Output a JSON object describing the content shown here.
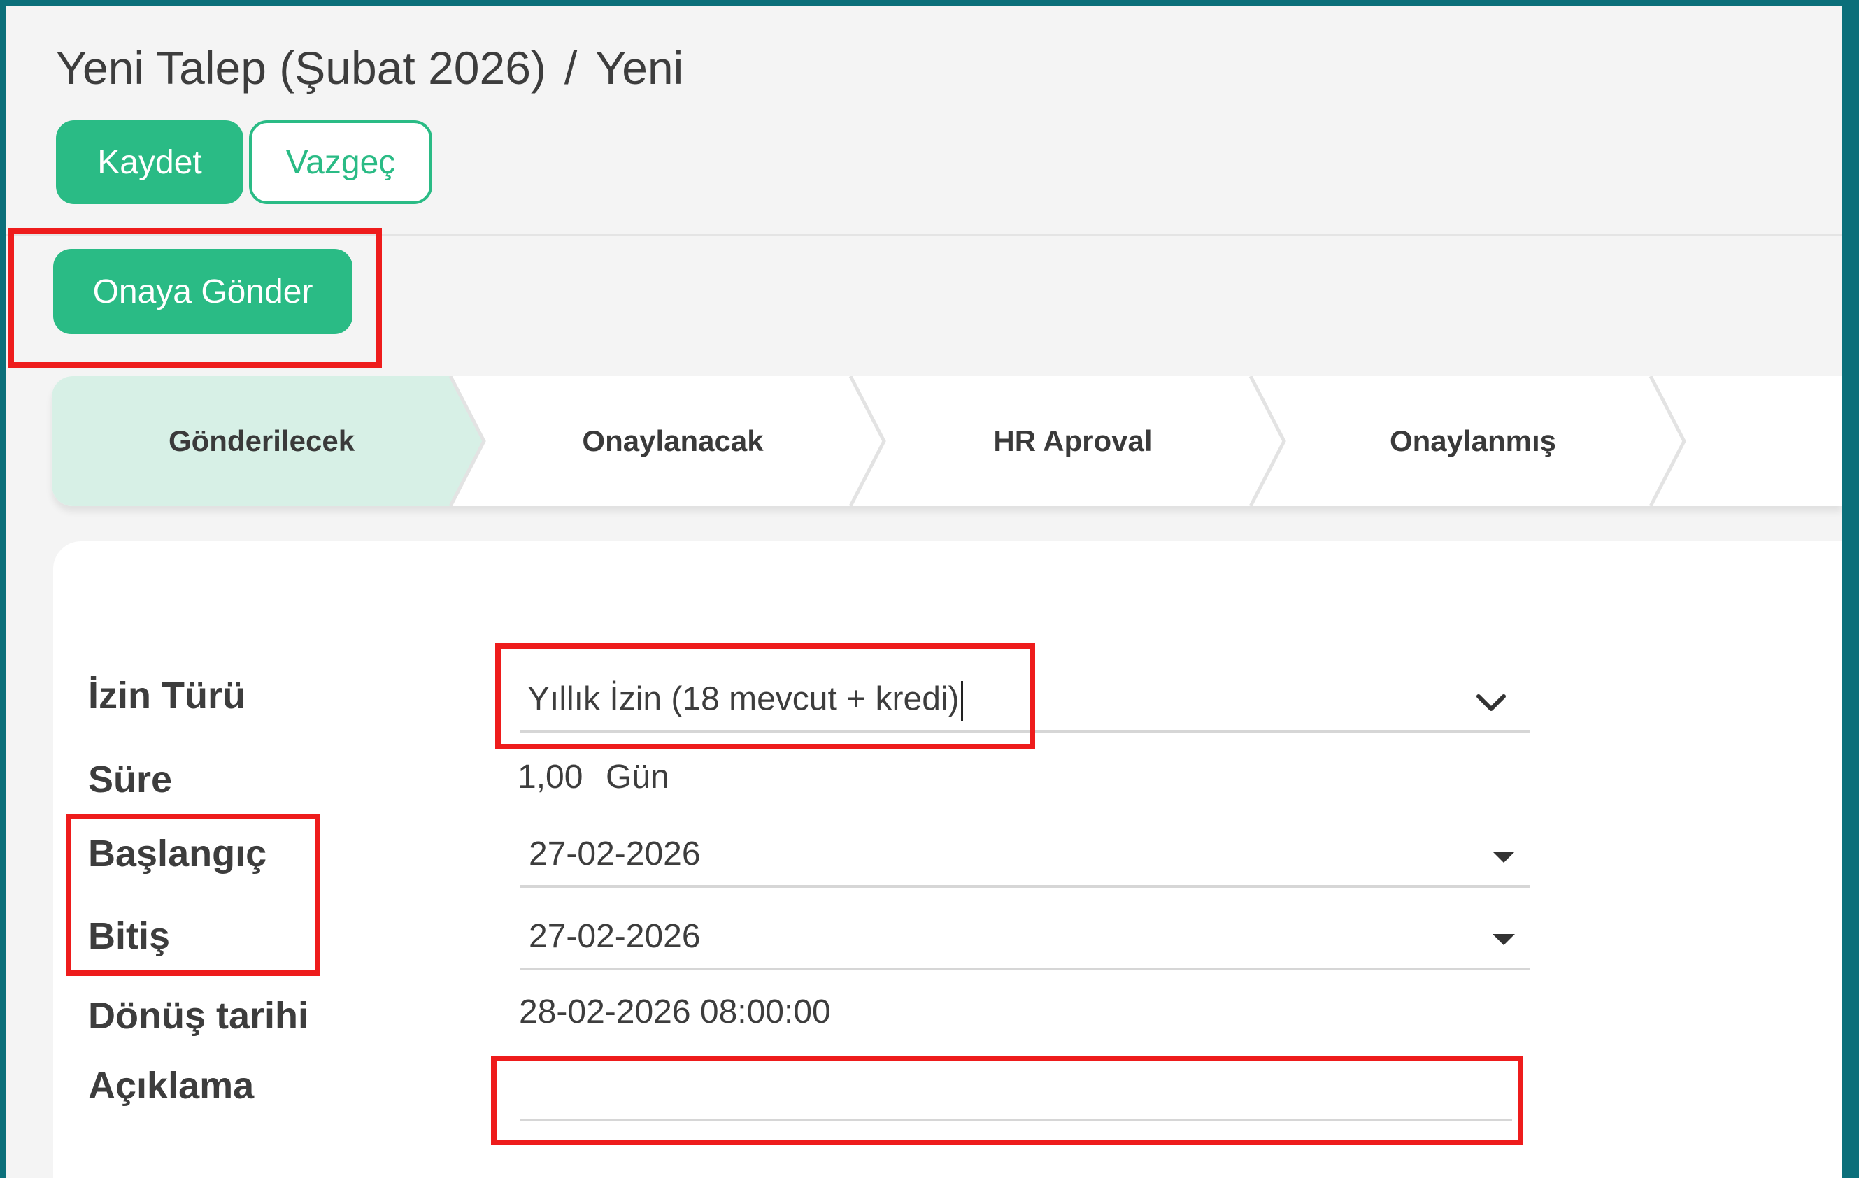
{
  "breadcrumb": {
    "parent": "Yeni Talep (Şubat 2026)",
    "separator": "/",
    "current": "Yeni"
  },
  "buttons": {
    "save": "Kaydet",
    "discard": "Vazgeç",
    "submit_for_approval": "Onaya Gönder"
  },
  "statusbar": {
    "stages": [
      {
        "label": "Gönderilecek",
        "active": true
      },
      {
        "label": "Onaylanacak",
        "active": false
      },
      {
        "label": "HR Aproval",
        "active": false
      },
      {
        "label": "Onaylanmış",
        "active": false
      }
    ]
  },
  "form": {
    "leave_type": {
      "label": "İzin Türü",
      "value": "Yıllık İzin (18 mevcut + kredi)"
    },
    "duration": {
      "label": "Süre",
      "value": "1,00",
      "unit": "Gün"
    },
    "start": {
      "label": "Başlangıç",
      "value": "27-02-2026"
    },
    "end": {
      "label": "Bitiş",
      "value": "27-02-2026"
    },
    "return_date": {
      "label": "Dönüş tarihi",
      "value": "28-02-2026 08:00:00"
    },
    "description": {
      "label": "Açıklama",
      "value": ""
    }
  },
  "colors": {
    "frame": "#0b6f7a",
    "accent": "#2abb85",
    "active_stage": "#d7f0e6",
    "highlight": "#ee1c1c"
  },
  "icons": {
    "leave_type_dropdown": "chevron-down-icon",
    "start_dropdown": "caret-down-icon",
    "end_dropdown": "caret-down-icon"
  }
}
